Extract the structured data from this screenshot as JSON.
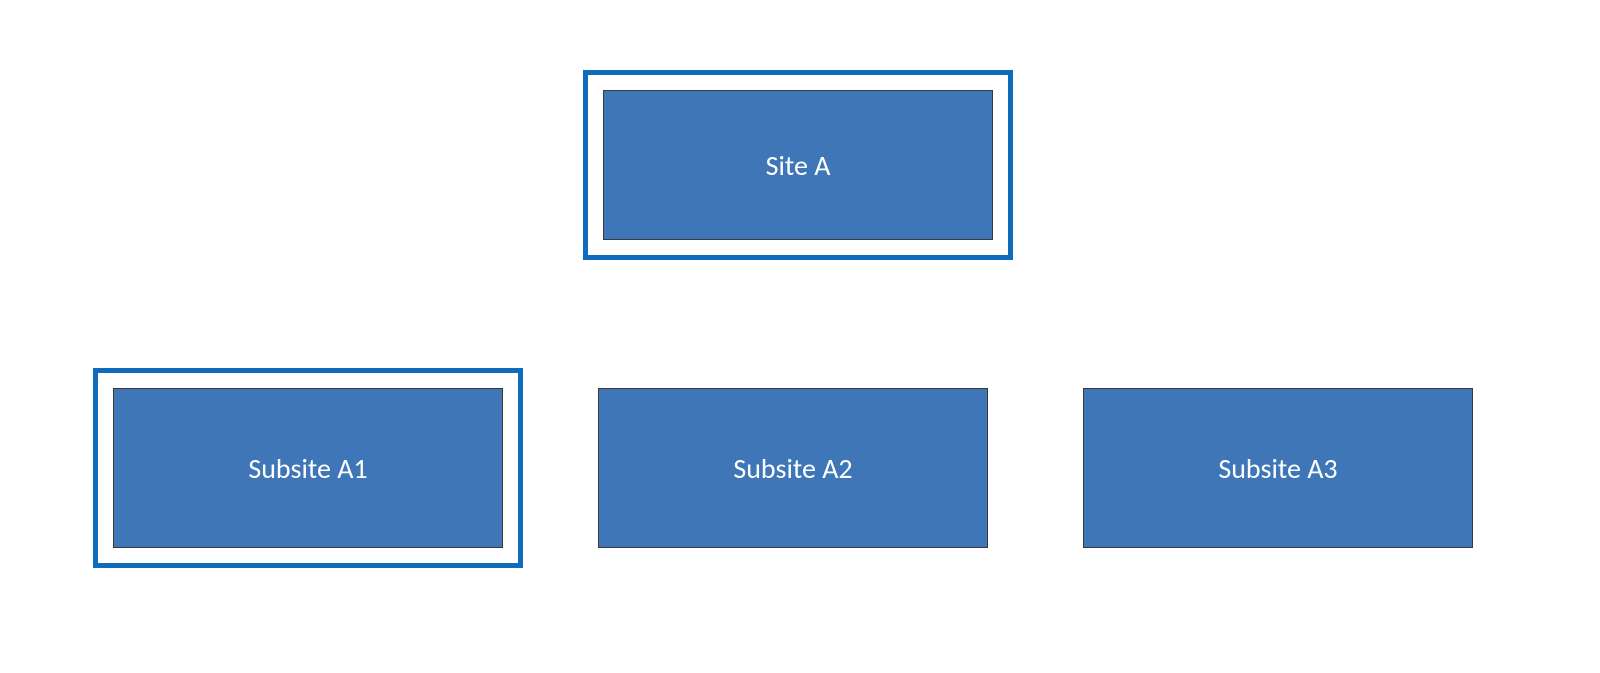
{
  "diagram": {
    "root": {
      "label": "Site A",
      "highlighted": true
    },
    "children": [
      {
        "label": "Subsite A1",
        "highlighted": true
      },
      {
        "label": "Subsite A2",
        "highlighted": false
      },
      {
        "label": "Subsite A3",
        "highlighted": false
      }
    ],
    "colors": {
      "node_fill": "#3e76b8",
      "node_border": "#3a3a3a",
      "highlight_border": "#0f6cbd",
      "text": "#ffffff"
    }
  }
}
